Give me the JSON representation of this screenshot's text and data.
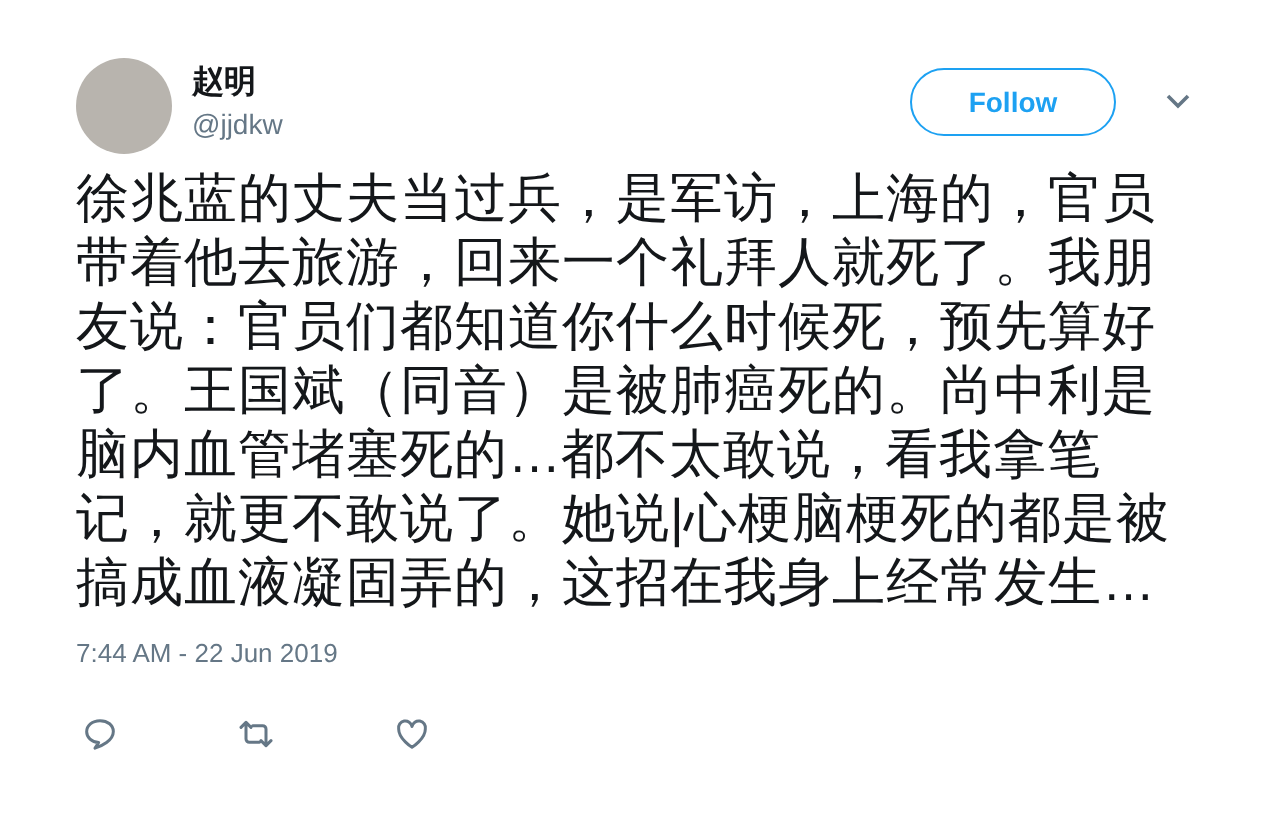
{
  "author": {
    "name": "赵明",
    "handle": "@jjdkw"
  },
  "follow_button": "Follow",
  "body": "徐兆蓝的丈夫当过兵，是军访，上海的，官员带着他去旅游，回来一个礼拜人就死了。我朋友说：官员们都知道你什么时候死，预先算好了。王国斌（同音）是被肺癌死的。尚中利是脑内血管堵塞死的…都不太敢说，看我拿笔记，就更不敢说了。她说|心梗脑梗死的都是被搞成血液凝固弄的，这招在我身上经常发生…",
  "timestamp": "7:44 AM - 22 Jun 2019",
  "actions": [
    {
      "kind": "reply"
    },
    {
      "kind": "retweet"
    },
    {
      "kind": "like"
    }
  ]
}
